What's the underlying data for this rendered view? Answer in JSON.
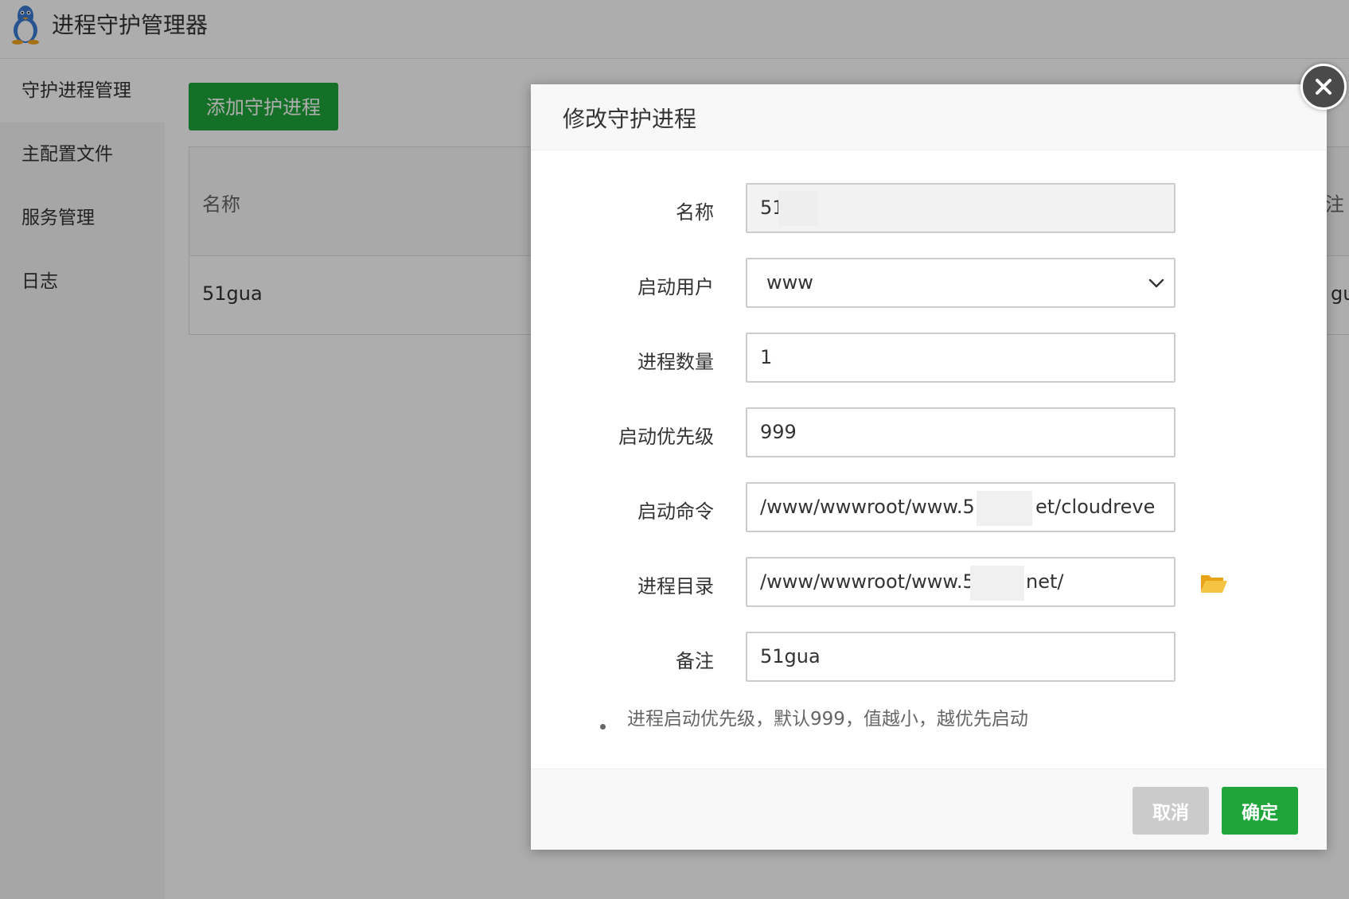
{
  "app": {
    "title": "进程守护管理器"
  },
  "sidebar": {
    "items": [
      {
        "label": "守护进程管理"
      },
      {
        "label": "主配置文件"
      },
      {
        "label": "服务管理"
      },
      {
        "label": "日志"
      }
    ]
  },
  "toolbar": {
    "add_label": "添加守护进程"
  },
  "table": {
    "headers": {
      "name": "名称",
      "note": "注"
    },
    "rows": [
      {
        "name": "51gua",
        "note": "gu"
      }
    ]
  },
  "dialog": {
    "title": "修改守护进程",
    "fields": {
      "name": {
        "label": "名称",
        "value": "51"
      },
      "user": {
        "label": "启动用户",
        "value": "www"
      },
      "count": {
        "label": "进程数量",
        "value": "1"
      },
      "priority": {
        "label": "启动优先级",
        "value": "999"
      },
      "command": {
        "label": "启动命令",
        "value": "/www/wwwroot/www.5",
        "value_tail": "et/cloudreve"
      },
      "directory": {
        "label": "进程目录",
        "value": "/www/wwwroot/www.5",
        "value_tail": "net/"
      },
      "note": {
        "label": "备注",
        "value": "51gua"
      }
    },
    "hint": "进程启动优先级，默认999，值越小，越优先启动",
    "buttons": {
      "cancel": "取消",
      "confirm": "确定"
    }
  },
  "colors": {
    "accent_green": "#20a53a",
    "cancel_gray": "#cbcbcb",
    "folder_yellow": "#f0b429"
  },
  "icons": {
    "logo": "linux-penguin-icon",
    "close": "close-icon",
    "dropdown": "chevron-down-icon",
    "folder": "folder-open-icon"
  }
}
